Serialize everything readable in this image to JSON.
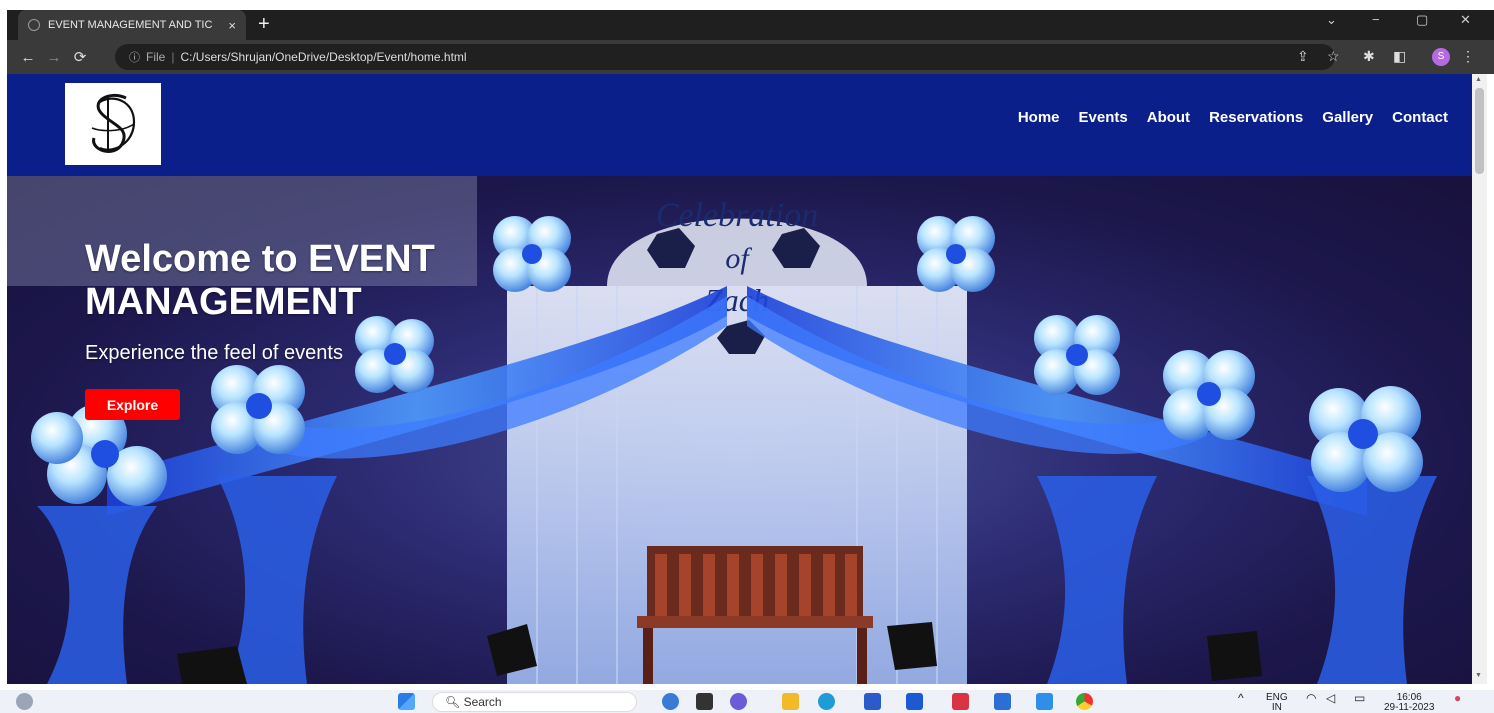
{
  "browser": {
    "tab_title": "EVENT MANAGEMENT AND TIC",
    "tab_close": "×",
    "new_tab": "+",
    "window_controls": [
      "⌄",
      "−",
      "▢",
      "✕"
    ],
    "address_scheme": "File",
    "address_url": "C:/Users/Shrujan/OneDrive/Desktop/Event/home.html",
    "profile_initial": "S"
  },
  "site": {
    "nav": [
      "Home",
      "Events",
      "About",
      "Reservations",
      "Gallery",
      "Contact"
    ],
    "hero_title_line1": "Welcome to EVENT",
    "hero_title_line2": "MANAGEMENT",
    "hero_subtitle": "Experience the feel of events",
    "explore_label": "Explore",
    "backdrop_text": [
      "Celebration",
      "of",
      "Zach"
    ],
    "colors": {
      "header": "#0a1f8a",
      "explore": "#ff0000"
    }
  },
  "taskbar": {
    "search_placeholder": "Search",
    "lang_top": "ENG",
    "lang_bottom": "IN",
    "time": "16:06",
    "date": "29-11-2023"
  }
}
